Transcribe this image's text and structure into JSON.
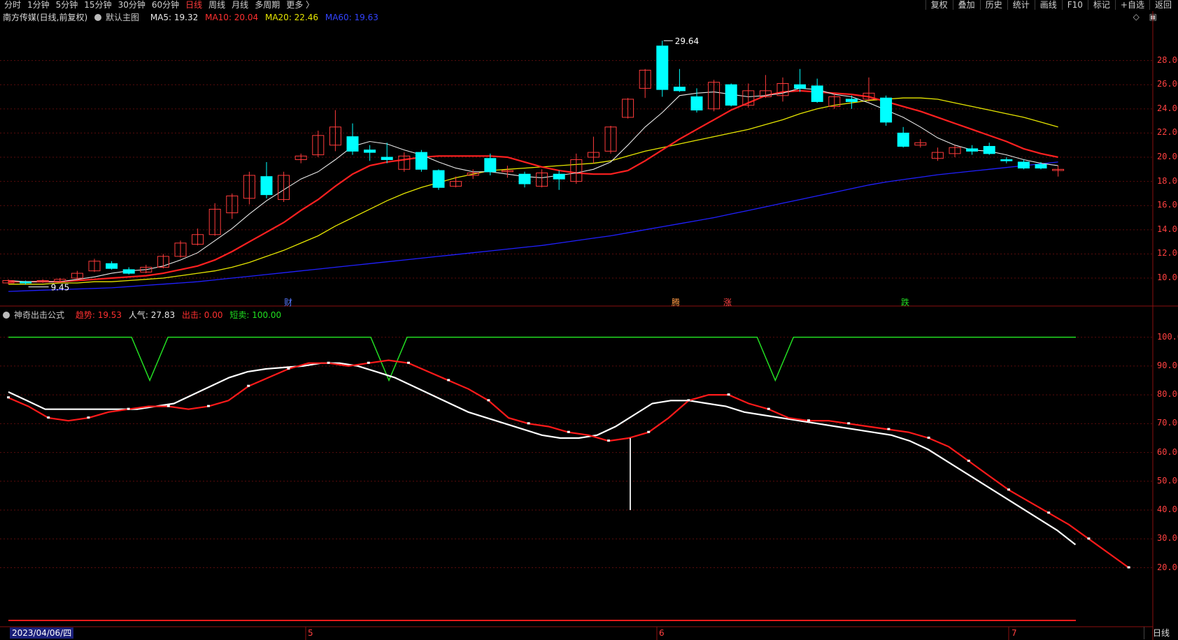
{
  "toolbar": {
    "periods": [
      "分时",
      "1分钟",
      "5分钟",
      "15分钟",
      "30分钟",
      "60分钟",
      "日线",
      "周线",
      "月线",
      "多周期",
      "更多 〉"
    ],
    "active_period": "日线",
    "right_buttons": [
      "复权",
      "叠加",
      "历史",
      "统计",
      "画线",
      "F10",
      "标记",
      "+自选",
      "返回"
    ]
  },
  "main_chart": {
    "stock_title": "南方传媒(日线,前复权)",
    "template": "默认主图",
    "ma5": "MA5: 19.32",
    "ma10": "MA10: 20.04",
    "ma20": "MA20: 22.46",
    "ma60": "MA60: 19.63",
    "high_label": "29.64",
    "low_label": "9.45",
    "y_ticks": [
      "28.00",
      "26.00",
      "24.00",
      "22.00",
      "20.00",
      "18.00",
      "16.00",
      "14.00",
      "12.00",
      "10.00"
    ],
    "events": [
      "财",
      "腾",
      "涨",
      "跌"
    ],
    "colors": {
      "ma5": "#e8e8e8",
      "ma10": "#ff2020",
      "ma20": "#e6e600",
      "ma60": "#2020ff",
      "up": "#ff3b3b",
      "down": "#00ffff"
    }
  },
  "indicator": {
    "name": "神奇出击公式",
    "trend": "趋势: 19.53",
    "popularity": "人气: 27.83",
    "strike": "出击: 0.00",
    "short_sell": "短卖: 100.00",
    "y_ticks": [
      "100.0",
      "90.00",
      "80.00",
      "70.00",
      "60.00",
      "50.00",
      "40.00",
      "30.00",
      "20.00"
    ]
  },
  "x_axis": {
    "cursor_date": "2023/04/06/四",
    "months": [
      "5",
      "6",
      "7"
    ]
  },
  "period_button": "日线",
  "chart_data": {
    "type": "candlestick",
    "ylim": [
      8.5,
      30
    ],
    "candles": [
      {
        "o": 9.6,
        "c": 9.8,
        "h": 9.9,
        "l": 9.5
      },
      {
        "o": 9.7,
        "c": 9.6,
        "h": 9.8,
        "l": 9.45
      },
      {
        "o": 9.7,
        "c": 9.8,
        "h": 9.9,
        "l": 9.6
      },
      {
        "o": 9.7,
        "c": 9.9,
        "h": 10.0,
        "l": 9.6
      },
      {
        "o": 10.0,
        "c": 10.4,
        "h": 10.6,
        "l": 9.9
      },
      {
        "o": 10.6,
        "c": 11.4,
        "h": 11.6,
        "l": 10.5
      },
      {
        "o": 11.2,
        "c": 10.8,
        "h": 11.4,
        "l": 10.7
      },
      {
        "o": 10.7,
        "c": 10.4,
        "h": 10.9,
        "l": 10.3
      },
      {
        "o": 10.5,
        "c": 10.9,
        "h": 11.1,
        "l": 10.4
      },
      {
        "o": 10.9,
        "c": 11.8,
        "h": 12.0,
        "l": 10.8
      },
      {
        "o": 11.8,
        "c": 12.9,
        "h": 13.1,
        "l": 11.7
      },
      {
        "o": 12.8,
        "c": 13.6,
        "h": 14.1,
        "l": 12.7
      },
      {
        "o": 13.6,
        "c": 15.7,
        "h": 16.2,
        "l": 13.5
      },
      {
        "o": 15.4,
        "c": 16.8,
        "h": 17.0,
        "l": 14.9
      },
      {
        "o": 16.6,
        "c": 18.5,
        "h": 18.8,
        "l": 16.1
      },
      {
        "o": 18.4,
        "c": 16.9,
        "h": 19.6,
        "l": 16.6
      },
      {
        "o": 16.5,
        "c": 18.5,
        "h": 18.8,
        "l": 16.3
      },
      {
        "o": 19.8,
        "c": 20.1,
        "h": 20.3,
        "l": 19.5
      },
      {
        "o": 20.2,
        "c": 21.8,
        "h": 22.2,
        "l": 20.0
      },
      {
        "o": 21.0,
        "c": 22.5,
        "h": 23.9,
        "l": 20.5
      },
      {
        "o": 21.7,
        "c": 20.5,
        "h": 22.8,
        "l": 20.2
      },
      {
        "o": 20.6,
        "c": 20.4,
        "h": 21.0,
        "l": 19.7
      },
      {
        "o": 20.0,
        "c": 19.8,
        "h": 21.2,
        "l": 19.5
      },
      {
        "o": 19.0,
        "c": 20.1,
        "h": 20.4,
        "l": 18.8
      },
      {
        "o": 20.4,
        "c": 19.0,
        "h": 20.6,
        "l": 18.8
      },
      {
        "o": 18.9,
        "c": 17.5,
        "h": 19.0,
        "l": 17.3
      },
      {
        "o": 17.6,
        "c": 18.0,
        "h": 18.4,
        "l": 17.5
      },
      {
        "o": 18.5,
        "c": 18.7,
        "h": 19.0,
        "l": 18.2
      },
      {
        "o": 19.9,
        "c": 18.8,
        "h": 20.3,
        "l": 18.5
      },
      {
        "o": 18.8,
        "c": 18.9,
        "h": 19.3,
        "l": 18.3
      },
      {
        "o": 18.6,
        "c": 17.8,
        "h": 18.8,
        "l": 17.5
      },
      {
        "o": 17.6,
        "c": 18.7,
        "h": 19.0,
        "l": 17.5
      },
      {
        "o": 18.6,
        "c": 18.2,
        "h": 18.9,
        "l": 17.3
      },
      {
        "o": 18.0,
        "c": 19.8,
        "h": 20.3,
        "l": 17.8
      },
      {
        "o": 20.0,
        "c": 20.4,
        "h": 21.7,
        "l": 19.5
      },
      {
        "o": 20.5,
        "c": 22.5,
        "h": 22.6,
        "l": 20.3
      },
      {
        "o": 23.3,
        "c": 24.8,
        "h": 24.9,
        "l": 23.2
      },
      {
        "o": 25.7,
        "c": 27.2,
        "h": 27.3,
        "l": 24.9
      },
      {
        "o": 29.2,
        "c": 25.6,
        "h": 29.64,
        "l": 25.0
      },
      {
        "o": 25.8,
        "c": 25.5,
        "h": 27.3,
        "l": 25.4
      },
      {
        "o": 25.0,
        "c": 23.9,
        "h": 25.7,
        "l": 23.7
      },
      {
        "o": 24.0,
        "c": 26.2,
        "h": 26.4,
        "l": 23.8
      },
      {
        "o": 26.0,
        "c": 24.3,
        "h": 26.1,
        "l": 24.2
      },
      {
        "o": 24.3,
        "c": 25.5,
        "h": 26.1,
        "l": 24.1
      },
      {
        "o": 25.0,
        "c": 25.5,
        "h": 26.8,
        "l": 24.9
      },
      {
        "o": 25.1,
        "c": 26.1,
        "h": 26.6,
        "l": 24.6
      },
      {
        "o": 26.0,
        "c": 25.7,
        "h": 27.3,
        "l": 25.4
      },
      {
        "o": 25.9,
        "c": 24.6,
        "h": 26.5,
        "l": 24.5
      },
      {
        "o": 24.2,
        "c": 25.0,
        "h": 25.3,
        "l": 24.0
      },
      {
        "o": 24.8,
        "c": 24.6,
        "h": 25.1,
        "l": 24.0
      },
      {
        "o": 24.8,
        "c": 25.3,
        "h": 26.6,
        "l": 24.6
      },
      {
        "o": 24.9,
        "c": 22.9,
        "h": 25.1,
        "l": 22.6
      },
      {
        "o": 22.0,
        "c": 20.9,
        "h": 22.5,
        "l": 20.8
      },
      {
        "o": 21.0,
        "c": 21.2,
        "h": 21.5,
        "l": 20.8
      },
      {
        "o": 19.9,
        "c": 20.4,
        "h": 20.8,
        "l": 19.7
      },
      {
        "o": 20.3,
        "c": 20.8,
        "h": 21.0,
        "l": 20.0
      },
      {
        "o": 20.7,
        "c": 20.5,
        "h": 21.0,
        "l": 20.2
      },
      {
        "o": 20.9,
        "c": 20.3,
        "h": 21.2,
        "l": 20.2
      },
      {
        "o": 19.8,
        "c": 19.7,
        "h": 20.0,
        "l": 19.5
      },
      {
        "o": 19.6,
        "c": 19.1,
        "h": 19.8,
        "l": 19.0
      },
      {
        "o": 19.4,
        "c": 19.1,
        "h": 19.6,
        "l": 19.0
      },
      {
        "o": 18.9,
        "c": 19.0,
        "h": 19.3,
        "l": 18.4
      }
    ],
    "ma5": [
      9.8,
      9.7,
      9.7,
      9.7,
      9.9,
      10.1,
      10.4,
      10.6,
      10.7,
      11.0,
      11.5,
      12.1,
      13.1,
      14.1,
      15.3,
      16.4,
      17.3,
      18.2,
      18.8,
      19.8,
      20.9,
      21.3,
      21.1,
      20.6,
      20.2,
      19.6,
      19.1,
      18.8,
      18.8,
      18.6,
      18.4,
      18.3,
      18.5,
      18.7,
      19.0,
      19.6,
      21.0,
      22.5,
      23.7,
      25.1,
      25.3,
      25.4,
      25.2,
      25.0,
      25.1,
      25.3,
      25.7,
      25.6,
      25.2,
      25.0,
      24.5,
      23.9,
      23.3,
      22.5,
      21.6,
      21.0,
      20.6,
      20.5,
      20.2,
      19.8,
      19.5,
      19.3
    ],
    "ma10": [
      9.7,
      9.7,
      9.7,
      9.7,
      9.8,
      9.9,
      10.0,
      10.1,
      10.2,
      10.4,
      10.7,
      11.0,
      11.5,
      12.2,
      13.0,
      13.8,
      14.6,
      15.6,
      16.5,
      17.6,
      18.6,
      19.3,
      19.6,
      19.8,
      20.0,
      20.1,
      20.1,
      20.1,
      20.1,
      20.0,
      19.6,
      19.2,
      18.9,
      18.7,
      18.6,
      18.6,
      18.9,
      19.7,
      20.6,
      21.5,
      22.3,
      23.1,
      23.9,
      24.5,
      25.1,
      25.4,
      25.5,
      25.4,
      25.3,
      25.2,
      25.0,
      24.6,
      24.2,
      23.8,
      23.3,
      22.8,
      22.3,
      21.8,
      21.3,
      20.7,
      20.3,
      20.0
    ],
    "ma20": [
      9.5,
      9.5,
      9.5,
      9.6,
      9.6,
      9.7,
      9.7,
      9.8,
      9.9,
      10.0,
      10.2,
      10.4,
      10.6,
      10.9,
      11.3,
      11.8,
      12.3,
      12.9,
      13.5,
      14.3,
      15.0,
      15.7,
      16.4,
      17.0,
      17.5,
      17.9,
      18.3,
      18.6,
      18.9,
      19.0,
      19.1,
      19.2,
      19.3,
      19.4,
      19.5,
      19.7,
      20.1,
      20.5,
      20.8,
      21.1,
      21.4,
      21.7,
      22.0,
      22.3,
      22.7,
      23.1,
      23.6,
      24.0,
      24.3,
      24.5,
      24.7,
      24.8,
      24.9,
      24.9,
      24.8,
      24.5,
      24.2,
      23.9,
      23.6,
      23.3,
      22.9,
      22.5
    ],
    "ma60": [
      8.9,
      8.95,
      9.0,
      9.05,
      9.1,
      9.15,
      9.2,
      9.3,
      9.4,
      9.5,
      9.6,
      9.7,
      9.85,
      10.0,
      10.15,
      10.3,
      10.45,
      10.6,
      10.75,
      10.9,
      11.05,
      11.2,
      11.35,
      11.5,
      11.65,
      11.8,
      11.95,
      12.1,
      12.25,
      12.4,
      12.55,
      12.7,
      12.9,
      13.1,
      13.3,
      13.5,
      13.75,
      14.0,
      14.25,
      14.5,
      14.75,
      15.0,
      15.3,
      15.6,
      15.9,
      16.2,
      16.5,
      16.8,
      17.1,
      17.4,
      17.7,
      17.95,
      18.15,
      18.35,
      18.55,
      18.7,
      18.85,
      19.0,
      19.15,
      19.3,
      19.45,
      19.6
    ],
    "indicator_series": {
      "popularity": [
        81,
        78,
        75,
        75,
        75,
        75,
        75,
        75,
        76,
        77,
        80,
        83,
        86,
        88,
        89,
        89.5,
        90,
        91,
        91,
        90,
        88,
        86,
        83,
        80,
        77,
        74,
        72,
        70,
        68,
        66,
        65,
        65,
        66,
        69,
        73,
        77,
        78,
        78,
        77,
        76,
        74,
        73,
        72,
        71,
        70,
        69,
        68,
        67,
        66,
        64,
        61,
        57,
        53,
        49,
        45,
        41,
        37,
        33,
        28
      ],
      "trend": [
        79,
        76,
        72,
        71,
        72,
        74,
        75,
        76,
        76,
        75,
        76,
        78,
        83,
        86,
        89,
        91,
        91,
        90,
        91,
        92,
        91,
        88,
        85,
        82,
        78,
        72,
        70,
        69,
        67,
        66,
        64,
        65,
        67,
        72,
        78,
        80,
        80,
        77,
        75,
        72,
        71,
        71,
        70,
        69,
        68,
        67,
        65,
        62,
        57,
        52,
        47,
        43,
        39,
        35,
        30,
        25,
        20
      ],
      "short_sell_dips_at": [
        7,
        20,
        41
      ],
      "strike_bar_at": 35
    }
  }
}
